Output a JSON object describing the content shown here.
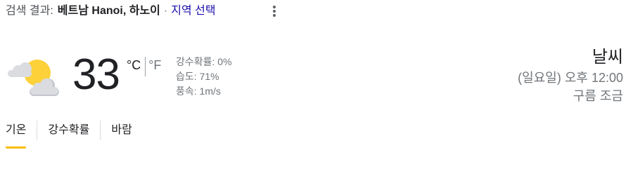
{
  "header": {
    "prefix": "검색 결과:",
    "location": "베트남 Hanoi, 하노이",
    "separator": "·",
    "select_label": "지역 선택",
    "more_icon": "more-vert-icon"
  },
  "current": {
    "icon": "partly-cloudy-icon",
    "temperature": "33",
    "unit_c": "°C",
    "unit_f": "°F",
    "precip": "강수확률: 0%",
    "humidity": "습도: 71%",
    "wind": "풍속: 1m/s"
  },
  "summary": {
    "title": "날씨",
    "time": "(일요일) 오후 12:00",
    "condition": "구름 조금"
  },
  "tabs": [
    {
      "label": "기온",
      "active": true
    },
    {
      "label": "강수확률",
      "active": false
    },
    {
      "label": "바람",
      "active": false
    }
  ],
  "colors": {
    "link": "#1a0dab",
    "accent": "#fbbc04",
    "sun": "#fcd13a",
    "cloud": "#dadce0"
  }
}
